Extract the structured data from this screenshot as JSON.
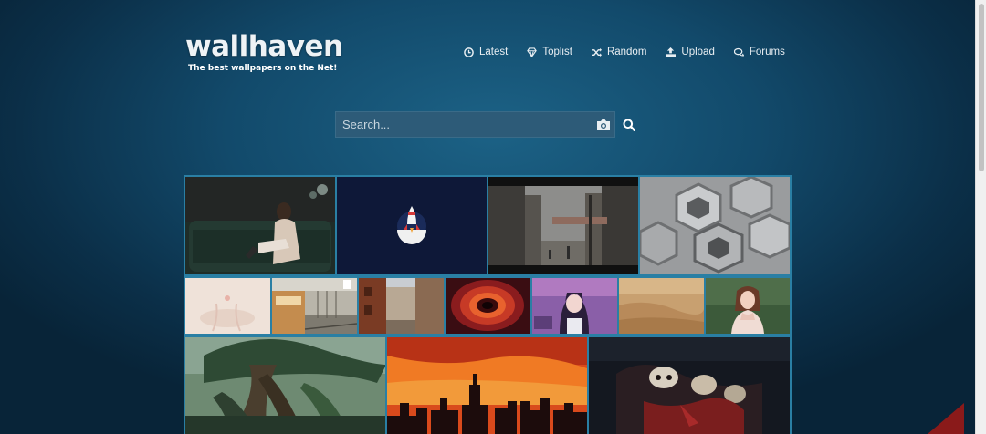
{
  "site": {
    "title": "wallhaven",
    "tagline": "The best wallpapers on the Net!"
  },
  "nav": {
    "items": [
      {
        "label": "Latest",
        "icon": "clock-icon"
      },
      {
        "label": "Toplist",
        "icon": "diamond-icon"
      },
      {
        "label": "Random",
        "icon": "shuffle-icon"
      },
      {
        "label": "Upload",
        "icon": "upload-icon"
      },
      {
        "label": "Forums",
        "icon": "chat-icon"
      }
    ]
  },
  "search": {
    "placeholder": "Search...",
    "value": "",
    "image_search_icon": "camera-icon",
    "submit_icon": "search-icon"
  },
  "colors": {
    "background": "#124a6b",
    "grid_border": "#2a7fa4",
    "search_bg": "#2d5b78",
    "ribbon": "#8a1a1a"
  },
  "wallpapers": [
    {
      "name": "wallpaper-woman-on-sofa",
      "row": 1
    },
    {
      "name": "wallpaper-rocket-minimal",
      "row": 1
    },
    {
      "name": "wallpaper-city-street",
      "row": 1
    },
    {
      "name": "wallpaper-hexagon-metal",
      "row": 1
    },
    {
      "name": "wallpaper-pale-abstract",
      "row": 2
    },
    {
      "name": "wallpaper-train-station",
      "row": 2
    },
    {
      "name": "wallpaper-alley-buildings",
      "row": 2
    },
    {
      "name": "wallpaper-red-vortex",
      "row": 2
    },
    {
      "name": "wallpaper-anime-girl",
      "row": 2
    },
    {
      "name": "wallpaper-desert-sand",
      "row": 2
    },
    {
      "name": "wallpaper-woman-portrait",
      "row": 2
    },
    {
      "name": "wallpaper-giant-tree",
      "row": 3
    },
    {
      "name": "wallpaper-sunset-skyline",
      "row": 3
    },
    {
      "name": "wallpaper-skull-art",
      "row": 3
    }
  ]
}
